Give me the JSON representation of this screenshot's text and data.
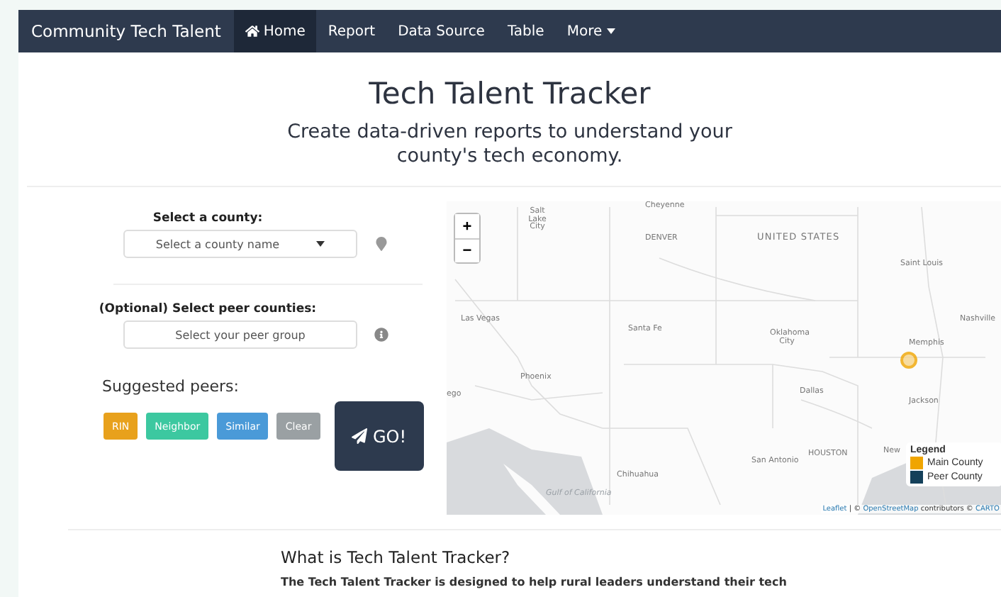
{
  "navbar": {
    "brand": "Community Tech Talent",
    "items": [
      {
        "label": "Home",
        "dropdown": false,
        "selected": true
      },
      {
        "label": "Report",
        "dropdown": false,
        "selected": false
      },
      {
        "label": "Data Source",
        "dropdown": false,
        "selected": false
      },
      {
        "label": "Table",
        "dropdown": false,
        "selected": false
      },
      {
        "label": "More",
        "dropdown": true,
        "selected": false
      }
    ]
  },
  "header": {
    "title": "Tech Talent Tracker",
    "subtitle": "Create data-driven reports to understand your county's tech economy."
  },
  "county_select": {
    "label": "Select a county:",
    "placeholder": "Select a county name"
  },
  "peer_select": {
    "label": "(Optional) Select peer counties:",
    "placeholder": "Select your peer group"
  },
  "suggested": {
    "label": "Suggested peers:",
    "buttons": [
      {
        "label": "RIN",
        "color": "#e8a11c"
      },
      {
        "label": "Neighbor",
        "color": "#3cc8a0"
      },
      {
        "label": "Similar",
        "color": "#4a9ad8"
      },
      {
        "label": "Clear",
        "color": "#9aa0a3"
      }
    ]
  },
  "go_button": {
    "label": "GO!"
  },
  "map": {
    "labels": [
      {
        "text": "Salt Lake City",
        "kind": "city"
      },
      {
        "text": "Cheyenne",
        "kind": "city"
      },
      {
        "text": "DENVER",
        "kind": "city"
      },
      {
        "text": "UNITED STATES",
        "kind": "country"
      },
      {
        "text": "Saint Louis",
        "kind": "city"
      },
      {
        "text": "Las Vegas",
        "kind": "city"
      },
      {
        "text": "Santa Fe",
        "kind": "city"
      },
      {
        "text": "Oklahoma City",
        "kind": "city"
      },
      {
        "text": "Nashville",
        "kind": "city"
      },
      {
        "text": "Memphis",
        "kind": "city"
      },
      {
        "text": "Phoenix",
        "kind": "city"
      },
      {
        "text": "ego",
        "kind": "city"
      },
      {
        "text": "Dallas",
        "kind": "city"
      },
      {
        "text": "Jackson",
        "kind": "city"
      },
      {
        "text": "New",
        "kind": "city"
      },
      {
        "text": "HOUSTON",
        "kind": "city"
      },
      {
        "text": "San Antonio",
        "kind": "city"
      },
      {
        "text": "Chihuahua",
        "kind": "city"
      },
      {
        "text": "Gulf of California",
        "kind": "water"
      }
    ],
    "zoom_in": "+",
    "zoom_out": "−",
    "legend": {
      "title": "Legend",
      "items": [
        {
          "label": "Main County",
          "color": "#f0a500"
        },
        {
          "label": "Peer County",
          "color": "#14405a"
        }
      ]
    },
    "attribution": [
      {
        "text": "Leaflet",
        "kind": "link"
      },
      {
        "text": "| ©",
        "kind": "text"
      },
      {
        "text": "OpenStreetMap",
        "kind": "link"
      },
      {
        "text": "contributors ©",
        "kind": "text"
      },
      {
        "text": "CARTO",
        "kind": "link"
      }
    ]
  },
  "about": {
    "heading": "What is Tech Talent Tracker?",
    "text": "The Tech Talent Tracker is designed to help rural leaders understand their tech"
  }
}
